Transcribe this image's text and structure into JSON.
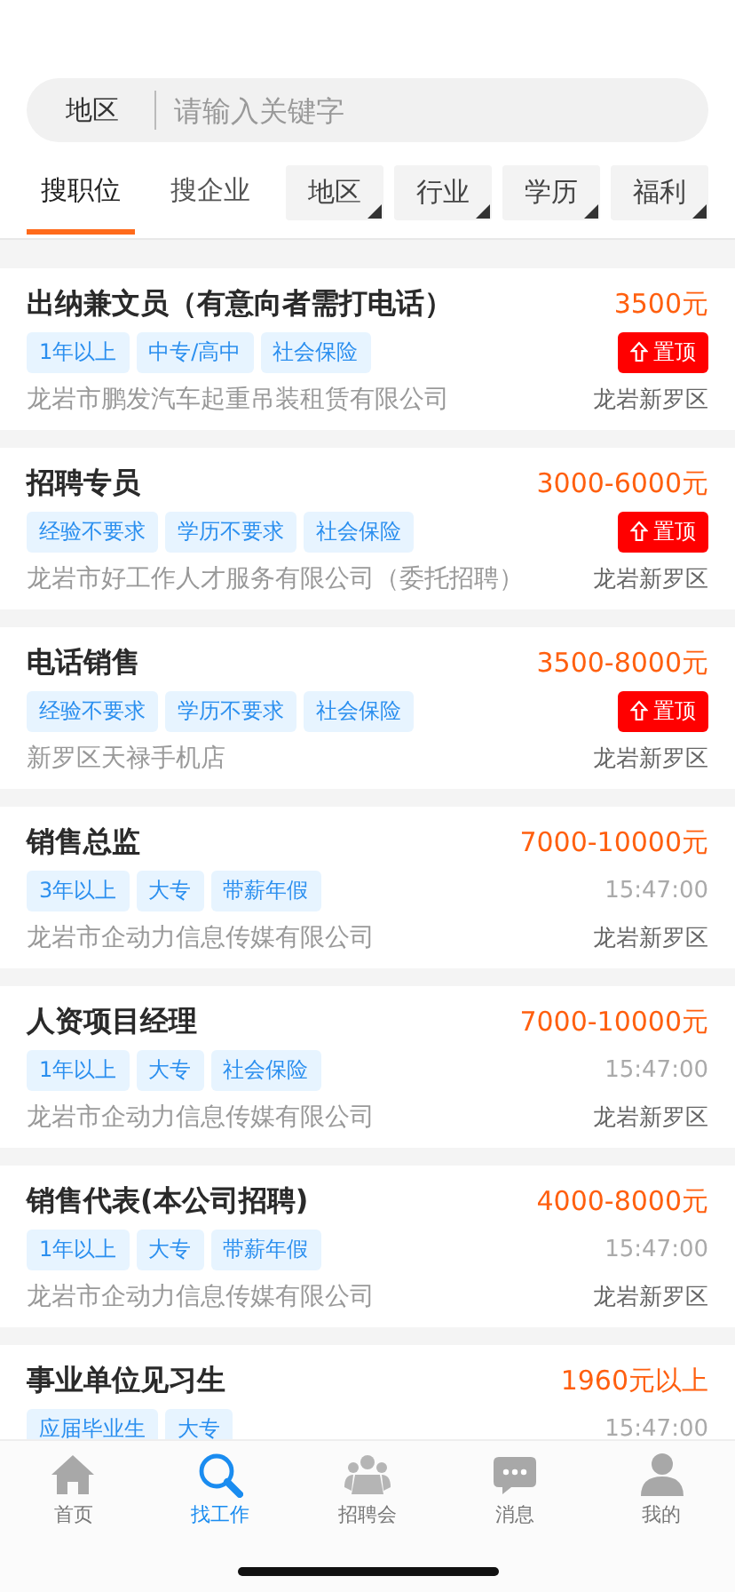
{
  "search": {
    "region": "地区",
    "placeholder": "请输入关键字"
  },
  "tabs": [
    {
      "label": "搜职位",
      "selected": true
    },
    {
      "label": "搜企业",
      "selected": false
    }
  ],
  "filters": [
    "地区",
    "行业",
    "学历",
    "福利"
  ],
  "jobs": [
    {
      "title": "出纳兼文员（有意向者需打电话）",
      "salary": "3500元",
      "tags": [
        "1年以上",
        "中专/高中",
        "社会保险"
      ],
      "pinned": true,
      "pin_label": "置顶",
      "company": "龙岩市鹏发汽车起重吊装租赁有限公司",
      "location": "龙岩新罗区"
    },
    {
      "title": "招聘专员",
      "salary": "3000-6000元",
      "tags": [
        "经验不要求",
        "学历不要求",
        "社会保险"
      ],
      "pinned": true,
      "pin_label": "置顶",
      "company": "龙岩市好工作人才服务有限公司（委托招聘）",
      "location": "龙岩新罗区"
    },
    {
      "title": "电话销售",
      "salary": "3500-8000元",
      "tags": [
        "经验不要求",
        "学历不要求",
        "社会保险"
      ],
      "pinned": true,
      "pin_label": "置顶",
      "company": "新罗区天禄手机店",
      "location": "龙岩新罗区"
    },
    {
      "title": "销售总监",
      "salary": "7000-10000元",
      "tags": [
        "3年以上",
        "大专",
        "带薪年假"
      ],
      "pinned": false,
      "time": "15:47:00",
      "company": "龙岩市企动力信息传媒有限公司",
      "location": "龙岩新罗区"
    },
    {
      "title": "人资项目经理",
      "salary": "7000-10000元",
      "tags": [
        "1年以上",
        "大专",
        "社会保险"
      ],
      "pinned": false,
      "time": "15:47:00",
      "company": "龙岩市企动力信息传媒有限公司",
      "location": "龙岩新罗区"
    },
    {
      "title": "销售代表(本公司招聘)",
      "salary": "4000-8000元",
      "tags": [
        "1年以上",
        "大专",
        "带薪年假"
      ],
      "pinned": false,
      "time": "15:47:00",
      "company": "龙岩市企动力信息传媒有限公司",
      "location": "龙岩新罗区"
    },
    {
      "title": "事业单位见习生",
      "salary": "1960元以上",
      "tags": [
        "应届毕业生",
        "大专"
      ],
      "pinned": false,
      "time": "15:47:00"
    }
  ],
  "nav": [
    {
      "label": "首页",
      "kind": "home",
      "selected": false
    },
    {
      "label": "找工作",
      "kind": "search",
      "selected": true
    },
    {
      "label": "招聘会",
      "kind": "fair",
      "selected": false
    },
    {
      "label": "消息",
      "kind": "message",
      "selected": false
    },
    {
      "label": "我的",
      "kind": "profile",
      "selected": false
    }
  ]
}
